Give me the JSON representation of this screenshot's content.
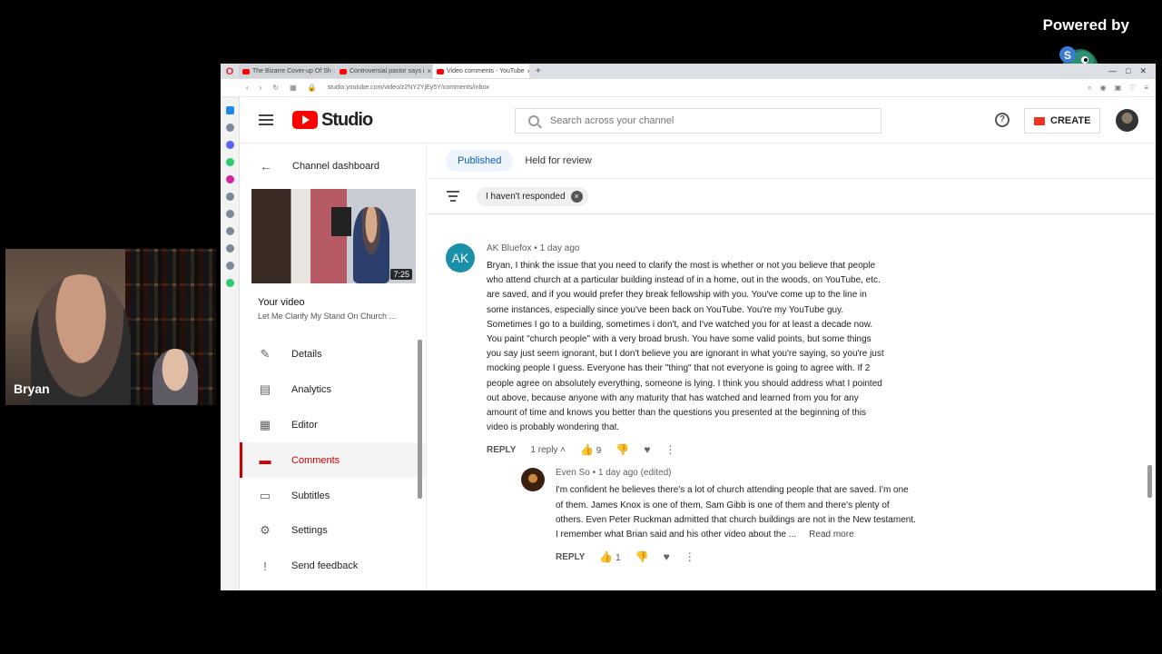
{
  "overlay": {
    "powered_by": "Powered by",
    "watermark": "StreamYard",
    "webcam_name": "Bryan"
  },
  "browser": {
    "tabs": [
      {
        "title": "The Bizarre Cover-up Of Sh"
      },
      {
        "title": "Controversial pastor says i"
      },
      {
        "title": "Video comments - YouTube"
      }
    ],
    "url": "studio.youtube.com/video/z2NY2YjEy5Y/comments/inbox"
  },
  "header": {
    "logo_text": "Studio",
    "search_placeholder": "Search across your channel",
    "create_label": "CREATE"
  },
  "sidebar": {
    "back_label": "Channel dashboard",
    "thumbnail_duration": "7:25",
    "your_video_label": "Your video",
    "video_title": "Let Me Clarify My Stand On Church ...",
    "items": [
      {
        "label": "Details",
        "icon": "pencil-icon"
      },
      {
        "label": "Analytics",
        "icon": "bar-chart-icon"
      },
      {
        "label": "Editor",
        "icon": "film-icon"
      },
      {
        "label": "Comments",
        "icon": "comment-icon",
        "active": true
      },
      {
        "label": "Subtitles",
        "icon": "subtitles-icon"
      },
      {
        "label": "Settings",
        "icon": "gear-icon"
      },
      {
        "label": "Send feedback",
        "icon": "feedback-icon"
      }
    ]
  },
  "main": {
    "tabs": [
      {
        "label": "Published",
        "active": true
      },
      {
        "label": "Held for review"
      }
    ],
    "filter_chip": "I haven't responded",
    "comment": {
      "avatar_initials": "AK",
      "author": "AK Bluefox",
      "separator": "•",
      "time": "1 day ago",
      "text": "Bryan, I think the issue that you need to clarify the most is whether or not you believe that people who attend church at a particular building instead of in a home, out in the woods, on YouTube, etc. are saved, and if you would prefer they break fellowship with you. You've come up to the line in some instances, especially since you've been back on YouTube. You're my YouTube guy. Sometimes I go to a building, sometimes i don't, and I've watched you for at least a decade now. You paint \"church people\" with a very broad brush. You have some valid points, but some things you say just seem ignorant, but I don't believe you are ignorant in what you're saying, so you're just mocking people I guess. Everyone has their \"thing\" that not everyone is going to agree with. If 2 people agree on absolutely everything, someone is lying. I think you should address what I pointed out above, because anyone with any maturity that has watched and learned from you for any amount of time and knows you better than the questions you presented at the beginning of this video is probably wondering that.",
      "reply_label": "REPLY",
      "replies_count": "1 reply",
      "likes": "9"
    },
    "reply": {
      "author": "Even So",
      "separator": "•",
      "time": "1 day ago (edited)",
      "text": "I'm confident he believes there's a lot of church attending people that are saved. I'm one of them. James Knox is one of them, Sam Gibb is one of them and there's plenty of others. Even Peter Ruckman admitted that church buildings are not in the New testament. I remember what Brian said and his other video about the ...",
      "read_more": "Read more",
      "reply_label": "REPLY",
      "likes": "1"
    }
  },
  "colors": {
    "accent_red": "#cc0000",
    "link_blue": "#0b5cad",
    "avatar_teal": "#1a90a8"
  }
}
